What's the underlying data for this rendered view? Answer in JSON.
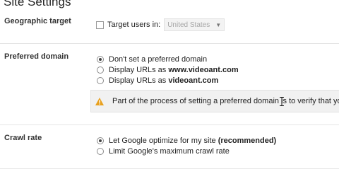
{
  "page": {
    "title": "Site Settings"
  },
  "geographic_target": {
    "label": "Geographic target",
    "checkbox_label": "Target users in:",
    "country_selected": "United States"
  },
  "preferred_domain": {
    "label": "Preferred domain",
    "options": [
      {
        "text": "Don't set a preferred domain",
        "checked": true
      },
      {
        "text": "Display URLs as ",
        "domain": "www.videoant.com",
        "checked": false
      },
      {
        "text": "Display URLs as ",
        "domain": "videoant.com",
        "checked": false
      }
    ],
    "info_message": "Part of the process of setting a preferred domain is to verify that you o"
  },
  "crawl_rate": {
    "label": "Crawl rate",
    "options": [
      {
        "text": "Let Google optimize for my site ",
        "bold": "(recommended)",
        "checked": true
      },
      {
        "text": "Limit Google's maximum crawl rate",
        "checked": false
      }
    ]
  },
  "colors": {
    "warning_icon": "#e8a01e",
    "divider": "#e5e5e5",
    "select_bg": "#f3f3f3"
  },
  "icons": {
    "warning": "warning-icon",
    "dropdown": "chevron-down-icon",
    "cursor": "text-cursor-icon"
  }
}
